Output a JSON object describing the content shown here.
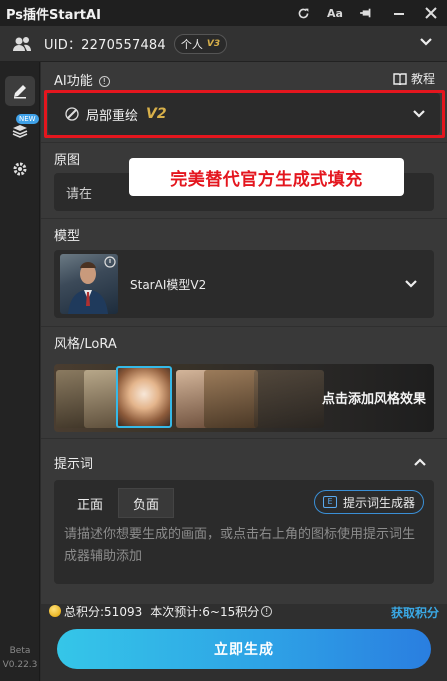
{
  "app": {
    "title": "Ps插件StartAI"
  },
  "titlebar": {
    "icons": [
      "refresh-icon",
      "font-size-icon",
      "pin-icon",
      "minimize-icon",
      "close-icon"
    ],
    "font_icon_text": "Aa"
  },
  "user": {
    "uid_label": "UID：2270557484",
    "plan": "个人",
    "plan_version": "V3"
  },
  "sidebar": {
    "items": [
      "edit-icon",
      "layers-icon",
      "gear-icon"
    ],
    "new_badge": "NEW",
    "beta": "Beta",
    "version": "V0.22.3"
  },
  "ai_function": {
    "label": "AI功能",
    "tutorial": "教程",
    "selected": "局部重绘",
    "selected_version": "V2",
    "callout": "完美替代官方生成式填充"
  },
  "source_image": {
    "label": "原图",
    "value": "请在"
  },
  "model": {
    "label": "模型",
    "name": "StarAI模型V2"
  },
  "style": {
    "label": "风格/LoRA",
    "cta": "点击添加风格效果"
  },
  "prompt": {
    "label": "提示词",
    "tabs": [
      "正面",
      "负面"
    ],
    "active_tab": 0,
    "generator_label": "提示词生成器",
    "generator_icon_text": "E",
    "placeholder": "请描述你想要生成的画面，或点击右上角的图标使用提示词生成器辅助添加"
  },
  "footer": {
    "total_points": "总积分:51093",
    "estimate": "本次预计:6~15积分",
    "get_points": "获取积分",
    "generate": "立即生成"
  },
  "colors": {
    "accent_red": "#e4161e",
    "accent_blue": "#2ea3e6",
    "gold": "#d8b04a"
  }
}
